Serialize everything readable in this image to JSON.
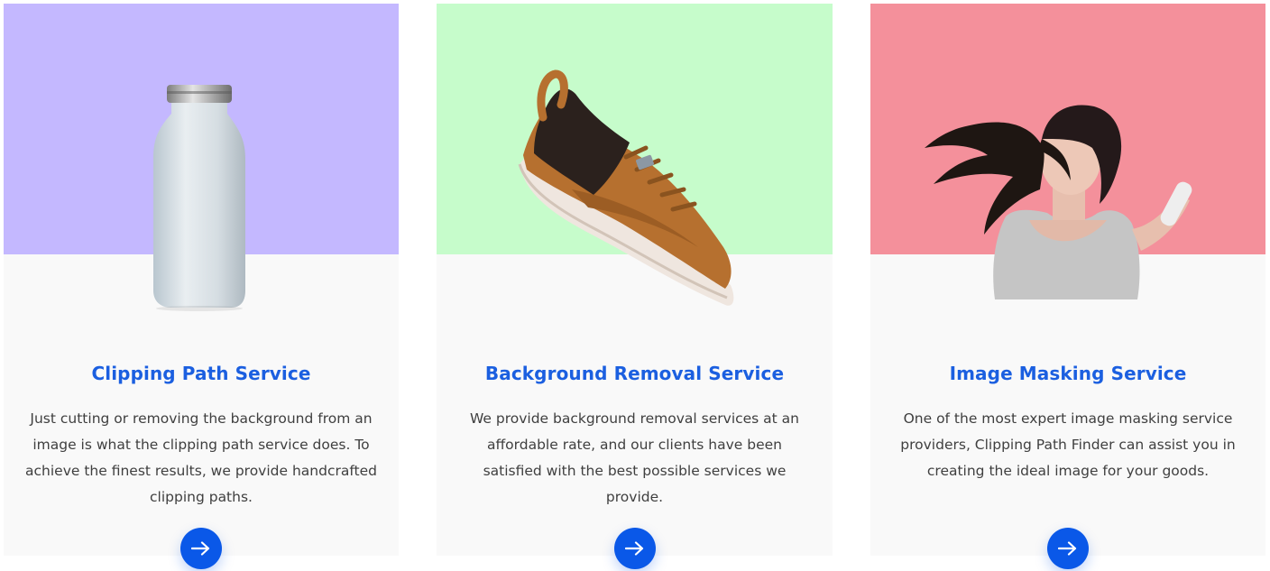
{
  "cards": [
    {
      "title": "Clipping Path Service",
      "description": "Just cutting or removing the background from an image is what the clipping path service does. To achieve the finest results, we provide handcrafted clipping paths.",
      "image": "white-bottle-image",
      "bg_color": "#c4b8ff",
      "button_icon": "arrow-right-icon"
    },
    {
      "title": "Background Removal Service",
      "description": "We provide background removal services at an affordable rate, and our clients have been satisfied with the best possible services we provide.",
      "image": "brown-sneaker-image",
      "bg_color": "#c6fccb",
      "button_icon": "arrow-right-icon"
    },
    {
      "title": "Image Masking Service",
      "description": "One of the most expert image masking service providers, Clipping Path Finder can assist you in creating the ideal image for your goods.",
      "image": "woman-hair-image",
      "bg_color": "#f4909b",
      "button_icon": "arrow-right-icon"
    }
  ],
  "colors": {
    "accent": "#0a58e8",
    "title": "#1b5fe0",
    "card_background": "#f9f9f9",
    "text": "#3f3f3f"
  }
}
